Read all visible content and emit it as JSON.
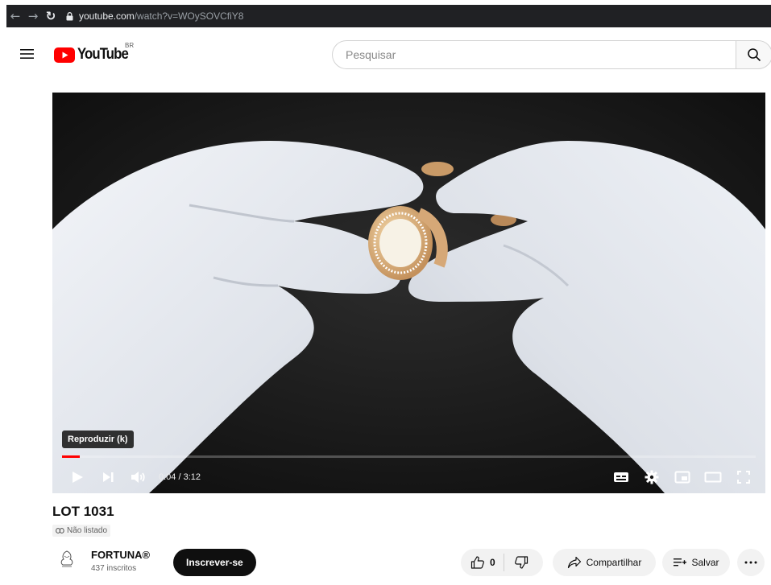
{
  "browser": {
    "url_host": "youtube.com",
    "url_path": "/watch?v=WOySOVCfiY8"
  },
  "header": {
    "logo_text": "YouTube",
    "country_code": "BR",
    "search_placeholder": "Pesquisar",
    "brand_color": "#ff0000"
  },
  "player": {
    "tooltip": "Reproduzir (k)",
    "time_display": "0:04 / 3:12",
    "progress_fraction": 0.025,
    "icons": [
      "play-icon",
      "next-icon",
      "volume-icon",
      "subtitles-icon",
      "settings-icon",
      "miniplayer-icon",
      "theater-icon",
      "fullscreen-icon"
    ]
  },
  "video": {
    "title": "LOT 1031",
    "privacy": "Não listado"
  },
  "channel": {
    "name": "FORTUNA®",
    "subscribers": "437 inscritos",
    "logo_caption": "FORTUNA",
    "subscribe_label": "Inscrever-se"
  },
  "actions": {
    "like_count": "0",
    "share_label": "Compartilhar",
    "save_label": "Salvar"
  }
}
